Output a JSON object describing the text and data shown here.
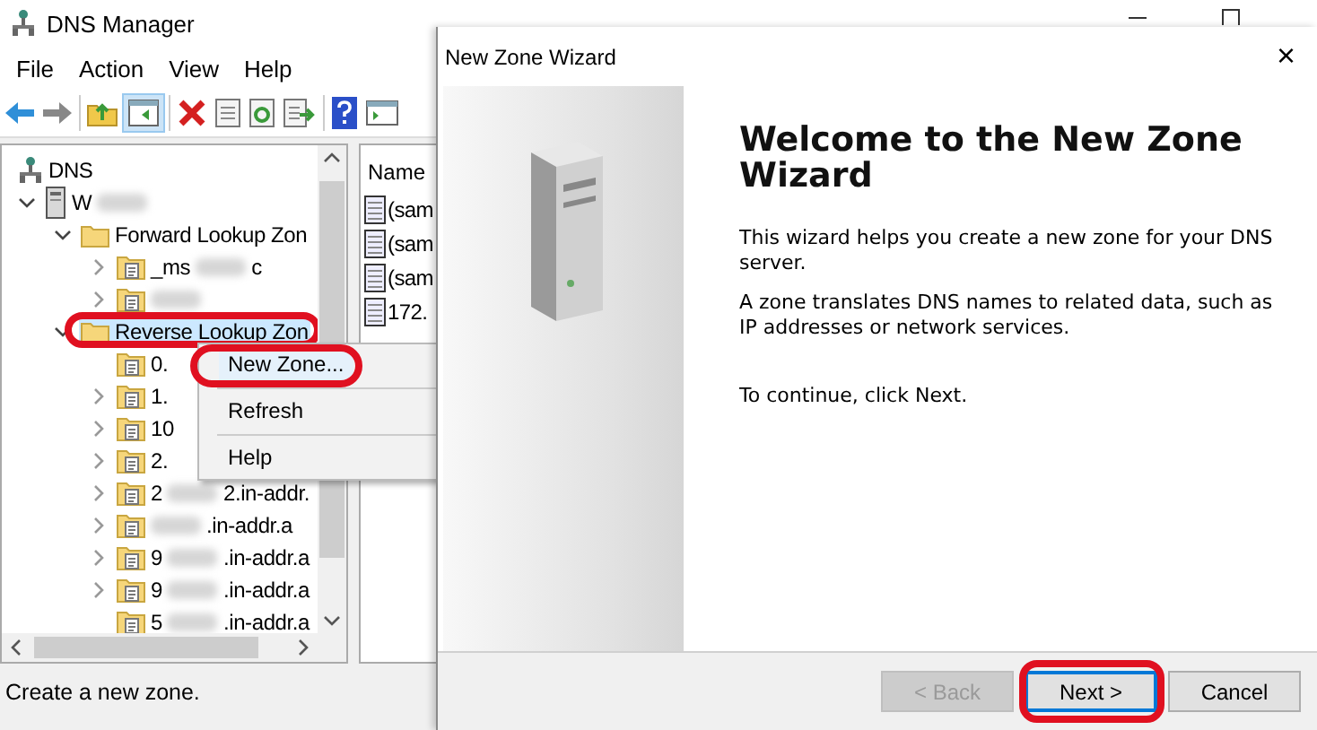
{
  "dns_window": {
    "title": "DNS Manager",
    "menu": [
      "File",
      "Action",
      "View",
      "Help"
    ],
    "tree": [
      {
        "kind": "root",
        "label": "DNS",
        "expander": false,
        "expanded": true,
        "highlighted": false,
        "children": [
          {
            "kind": "server",
            "label": "W",
            "redacted": true,
            "expander": true,
            "expanded": true,
            "highlighted": false,
            "children": [
              {
                "kind": "folder",
                "label": "Forward Lookup Zon",
                "expander": true,
                "expanded": true,
                "highlighted": false,
                "children": [
                  {
                    "kind": "zone",
                    "label": "_ms",
                    "redacted": true,
                    "suffix": "c",
                    "expander": true,
                    "expanded": false,
                    "highlighted": false
                  },
                  {
                    "kind": "zone",
                    "redacted": true,
                    "expander": true,
                    "expanded": false,
                    "highlighted": false
                  }
                ]
              },
              {
                "kind": "folder",
                "label": "Reverse Lookup Zon",
                "expander": true,
                "expanded": true,
                "highlighted": true,
                "children": [
                  {
                    "kind": "zone",
                    "label": "0.",
                    "expander": false,
                    "highlighted": false
                  },
                  {
                    "kind": "zone",
                    "label": "1.",
                    "expander": true,
                    "expanded": false,
                    "highlighted": false
                  },
                  {
                    "kind": "zone",
                    "label": "10",
                    "expander": true,
                    "expanded": false,
                    "highlighted": false
                  },
                  {
                    "kind": "zone",
                    "label": "2.",
                    "expander": true,
                    "expanded": false,
                    "highlighted": false
                  },
                  {
                    "kind": "zone",
                    "label": "2",
                    "redacted": true,
                    "suffix": "2.in-addr.",
                    "expander": true,
                    "expanded": false,
                    "highlighted": false
                  },
                  {
                    "kind": "zone",
                    "redacted": true,
                    "suffix": ".in-addr.a",
                    "expander": true,
                    "expanded": false,
                    "highlighted": false
                  },
                  {
                    "kind": "zone",
                    "label": "9",
                    "redacted": true,
                    "suffix": ".in-addr.a",
                    "expander": true,
                    "expanded": false,
                    "highlighted": false
                  },
                  {
                    "kind": "zone",
                    "label": "9",
                    "redacted": true,
                    "suffix": ".in-addr.a",
                    "expander": true,
                    "expanded": false,
                    "highlighted": false
                  },
                  {
                    "kind": "zone",
                    "label": "5",
                    "redacted": true,
                    "suffix": ".in-addr.a",
                    "expander": false,
                    "highlighted": false
                  }
                ]
              }
            ]
          }
        ]
      }
    ],
    "list": {
      "column": "Name",
      "rows": [
        "(sam",
        "(sam",
        "(sam",
        "172."
      ]
    },
    "context_menu": [
      {
        "label": "New Zone...",
        "highlighted": true
      },
      {
        "label": "Refresh",
        "highlighted": false
      },
      {
        "label": "Help",
        "highlighted": false
      }
    ],
    "status_bar": "Create a new zone."
  },
  "wizard": {
    "title": "New Zone Wizard",
    "close": "×",
    "heading": "Welcome to the New Zone Wizard",
    "paragraphs": [
      "This wizard helps you create a new zone for your DNS server.",
      "A zone translates DNS names to related data, such as IP addresses or network services.",
      "To continue, click Next."
    ],
    "buttons": [
      {
        "label": "< Back",
        "disabled": true,
        "default": false,
        "highlighted": false
      },
      {
        "label": "Next >",
        "disabled": false,
        "default": true,
        "highlighted": true
      },
      {
        "label": "Cancel",
        "disabled": false,
        "default": false,
        "highlighted": false
      }
    ]
  }
}
